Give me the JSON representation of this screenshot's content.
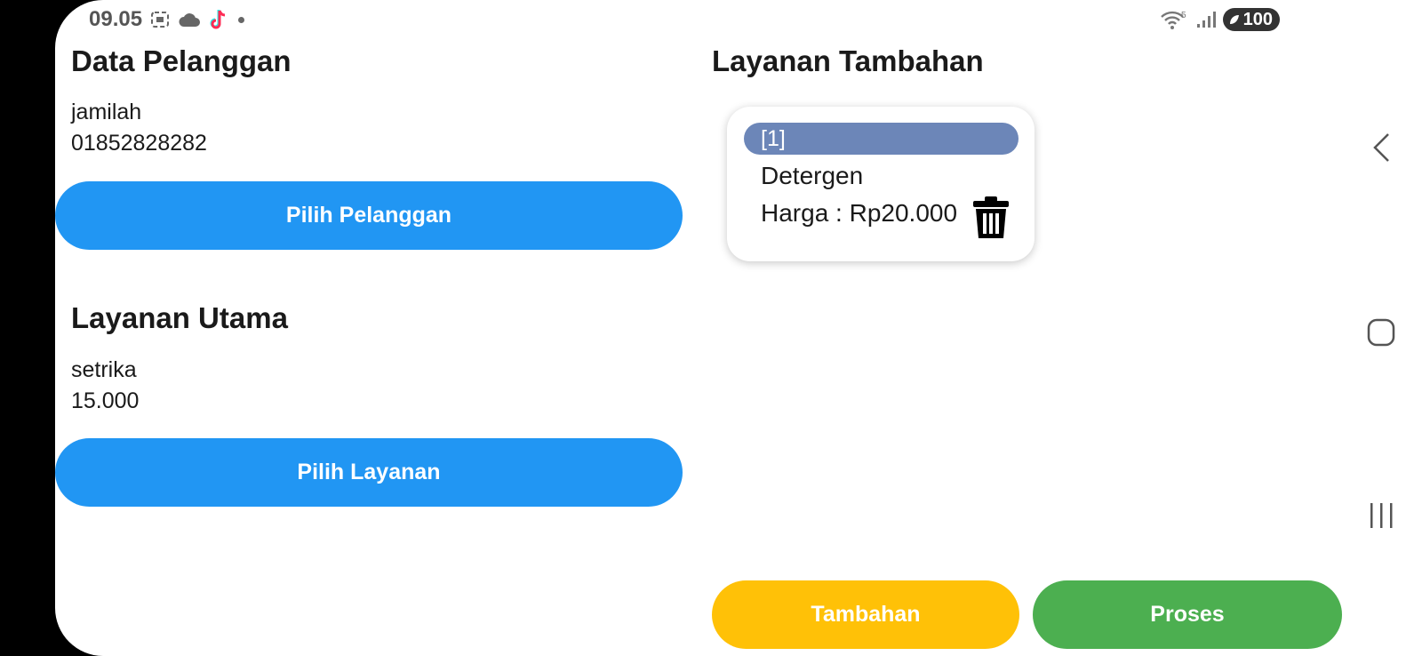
{
  "status_bar": {
    "time": "09.05",
    "icons": [
      "screenshot-icon",
      "cloud-icon",
      "tiktok-icon",
      "notification-dot-icon"
    ],
    "signal_icons": [
      "wifi-icon",
      "signal-icon"
    ],
    "wifi_label": "5",
    "battery": "100"
  },
  "customer": {
    "title": "Data Pelanggan",
    "name": "jamilah",
    "phone": "01852828282",
    "button_label": "Pilih Pelanggan"
  },
  "main_service": {
    "title": "Layanan Utama",
    "name": "setrika",
    "price": "15.000",
    "button_label": "Pilih Layanan"
  },
  "extra_services": {
    "title": "Layanan Tambahan",
    "items": [
      {
        "index": "[1]",
        "name": "Detergen",
        "price": "Harga : Rp20.000",
        "icon": "trash-icon"
      }
    ]
  },
  "actions": {
    "extra_label": "Tambahan",
    "process_label": "Proses"
  },
  "nav_bar": {
    "icons": [
      "back-icon",
      "home-icon",
      "recents-icon"
    ]
  },
  "colors": {
    "primary": "#2196f3",
    "extra_button": "#ffc107",
    "process_button": "#4caf50",
    "chip": "#6c86b8"
  }
}
